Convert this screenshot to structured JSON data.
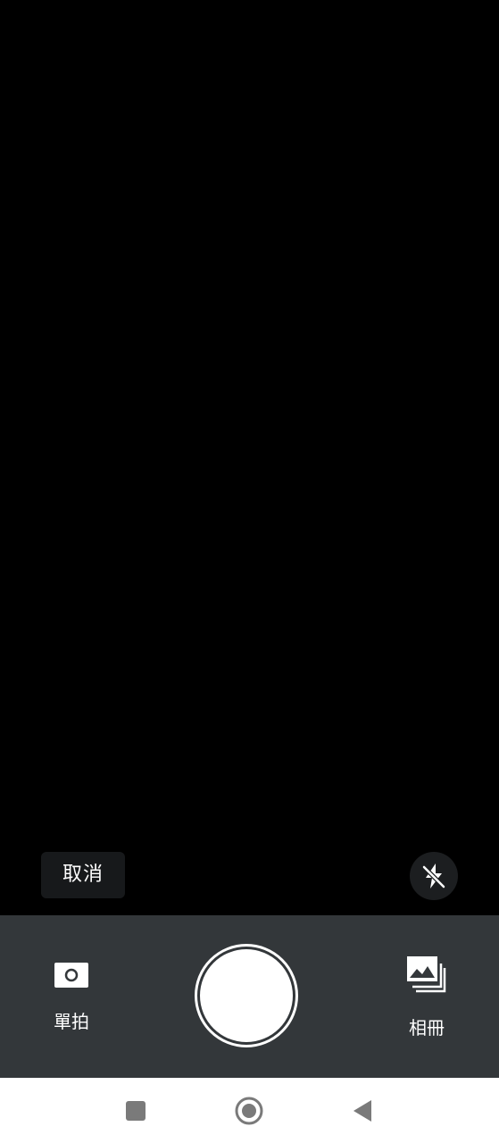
{
  "camera": {
    "cancel_label": "取消",
    "flash_icon": "flash-off-icon",
    "modes": {
      "single": {
        "label": "單拍",
        "icon": "single-shot-icon"
      },
      "album": {
        "label": "相冊",
        "icon": "album-icon"
      }
    },
    "shutter_icon": "shutter-button"
  },
  "navbar": {
    "recents_icon": "recents-icon",
    "home_icon": "home-icon",
    "back_icon": "back-icon"
  },
  "colors": {
    "viewfinder": "#000000",
    "control_bar": "#33373a",
    "nav_bar": "#ffffff",
    "nav_icon": "#7a7a7a"
  }
}
